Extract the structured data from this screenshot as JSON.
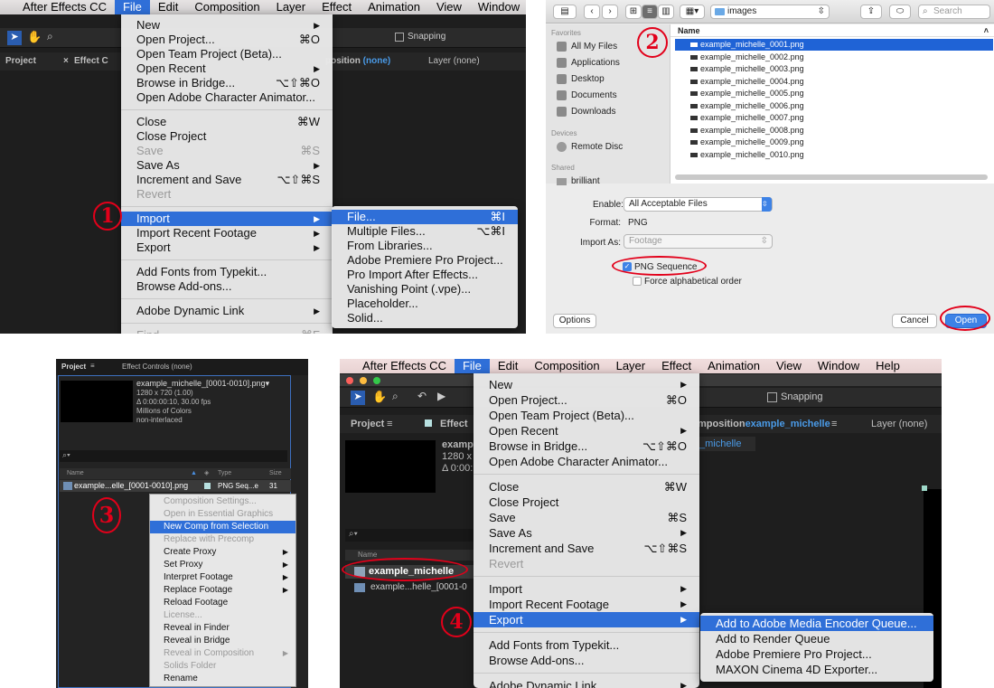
{
  "panel1": {
    "menubar": [
      "After Effects CC",
      "File",
      "Edit",
      "Composition",
      "Layer",
      "Effect",
      "Animation",
      "View",
      "Window",
      "Help"
    ],
    "tab_project": "Project",
    "tab_effect": "Effect C",
    "tab_comp": "position",
    "tab_comp_value": "(none)",
    "tab_layer": "Layer (none)",
    "snapping": "Snapping",
    "step": "1",
    "file_menu": [
      {
        "label": "New",
        "sc": "",
        "arrow": true
      },
      {
        "label": "Open Project...",
        "sc": "⌘O"
      },
      {
        "label": "Open Team Project (Beta)...",
        "sc": ""
      },
      {
        "label": "Open Recent",
        "sc": "",
        "arrow": true
      },
      {
        "label": "Browse in Bridge...",
        "sc": "⌥⇧⌘O"
      },
      {
        "label": "Open Adobe Character Animator...",
        "sc": ""
      },
      {
        "sep": true
      },
      {
        "label": "Close",
        "sc": "⌘W"
      },
      {
        "label": "Close Project",
        "sc": ""
      },
      {
        "label": "Save",
        "sc": "⌘S",
        "dis": true
      },
      {
        "label": "Save As",
        "sc": "",
        "arrow": true
      },
      {
        "label": "Increment and Save",
        "sc": "⌥⇧⌘S"
      },
      {
        "label": "Revert",
        "sc": "",
        "dis": true
      },
      {
        "sep": true
      },
      {
        "label": "Import",
        "sc": "",
        "arrow": true,
        "hl": true
      },
      {
        "label": "Import Recent Footage",
        "sc": "",
        "arrow": true
      },
      {
        "label": "Export",
        "sc": "",
        "arrow": true
      },
      {
        "sep": true
      },
      {
        "label": "Add Fonts from Typekit...",
        "sc": ""
      },
      {
        "label": "Browse Add-ons...",
        "sc": ""
      },
      {
        "sep": true
      },
      {
        "label": "Adobe Dynamic Link",
        "sc": "",
        "arrow": true
      },
      {
        "sep": true
      },
      {
        "label": "Find...",
        "sc": "⌘F",
        "dis": true
      }
    ],
    "import_menu": [
      {
        "label": "File...",
        "sc": "⌘I",
        "hl": true
      },
      {
        "label": "Multiple Files...",
        "sc": "⌥⌘I"
      },
      {
        "label": "From Libraries...",
        "sc": ""
      },
      {
        "label": "Adobe Premiere Pro Project...",
        "sc": ""
      },
      {
        "label": "Pro Import After Effects...",
        "sc": ""
      },
      {
        "label": "Vanishing Point (.vpe)...",
        "sc": ""
      },
      {
        "label": "Placeholder...",
        "sc": ""
      },
      {
        "label": "Solid...",
        "sc": ""
      }
    ]
  },
  "panel2": {
    "step": "2",
    "path": "images",
    "search_placeholder": "Search",
    "favorites_head": "Favorites",
    "favorites": [
      "All My Files",
      "Applications",
      "Desktop",
      "Documents",
      "Downloads"
    ],
    "devices_head": "Devices",
    "devices": [
      "Remote Disc"
    ],
    "shared_head": "Shared",
    "shared": [
      "brilliant"
    ],
    "column_name": "Name",
    "files": [
      "example_michelle_0001.png",
      "example_michelle_0002.png",
      "example_michelle_0003.png",
      "example_michelle_0004.png",
      "example_michelle_0005.png",
      "example_michelle_0006.png",
      "example_michelle_0007.png",
      "example_michelle_0008.png",
      "example_michelle_0009.png",
      "example_michelle_0010.png"
    ],
    "enable_label": "Enable:",
    "enable_value": "All Acceptable Files",
    "format_label": "Format:",
    "format_value": "PNG",
    "import_as_label": "Import As:",
    "import_as_value": "Footage",
    "png_sequence": "PNG Sequence",
    "force_alpha": "Force alphabetical order",
    "options": "Options",
    "cancel": "Cancel",
    "open": "Open"
  },
  "panel3": {
    "step": "3",
    "tab_project": "Project",
    "tab_effect": "Effect Controls (none)",
    "item_name": "example_michelle_[0001-0010].png▾",
    "info": [
      "1280 x 720 (1.00)",
      "Δ 0:00:00:10, 30.00 fps",
      "Millions of Colors",
      "non-interlaced"
    ],
    "col_name": "Name",
    "col_type": "Type",
    "col_size": "Size",
    "row_name": "example...elle_[0001-0010].png",
    "row_type": "PNG Seq...e",
    "row_size": "31",
    "context_menu": [
      {
        "label": "Composition Settings...",
        "dis": true
      },
      {
        "label": "Open in Essential Graphics",
        "dis": true
      },
      {
        "label": "New Comp from Selection",
        "hl": true
      },
      {
        "label": "Replace with Precomp",
        "dis": true
      },
      {
        "label": "Create Proxy",
        "arrow": true
      },
      {
        "label": "Set Proxy",
        "arrow": true
      },
      {
        "label": "Interpret Footage",
        "arrow": true
      },
      {
        "label": "Replace Footage",
        "arrow": true
      },
      {
        "label": "Reload Footage"
      },
      {
        "label": "License...",
        "dis": true
      },
      {
        "label": "Reveal in Finder"
      },
      {
        "label": "Reveal in Bridge"
      },
      {
        "label": "Reveal in Composition",
        "dis": true,
        "arrow": true
      },
      {
        "label": "Solids Folder",
        "dis": true
      },
      {
        "label": "Rename"
      }
    ]
  },
  "panel4": {
    "step": "4",
    "menubar": [
      "After Effects CC",
      "File",
      "Edit",
      "Composition",
      "Layer",
      "Effect",
      "Animation",
      "View",
      "Window",
      "Help"
    ],
    "tab_project": "Project",
    "tab_effect": "Effect",
    "tab_comp": "mposition",
    "tab_comp_value": "example_michelle",
    "tab_layer": "Layer (none)",
    "comp_tab": "_michelle",
    "snapping": "Snapping",
    "info_partial": [
      "examp",
      "1280 x",
      "Δ 0:00:"
    ],
    "col_name": "Name",
    "item1": "example_michelle",
    "item2": "example...helle_[0001-0",
    "file_menu": [
      {
        "label": "New",
        "sc": "",
        "arrow": true
      },
      {
        "label": "Open Project...",
        "sc": "⌘O"
      },
      {
        "label": "Open Team Project (Beta)...",
        "sc": ""
      },
      {
        "label": "Open Recent",
        "sc": "",
        "arrow": true
      },
      {
        "label": "Browse in Bridge...",
        "sc": "⌥⇧⌘O"
      },
      {
        "label": "Open Adobe Character Animator...",
        "sc": ""
      },
      {
        "sep": true
      },
      {
        "label": "Close",
        "sc": "⌘W"
      },
      {
        "label": "Close Project",
        "sc": ""
      },
      {
        "label": "Save",
        "sc": "⌘S"
      },
      {
        "label": "Save As",
        "sc": "",
        "arrow": true
      },
      {
        "label": "Increment and Save",
        "sc": "⌥⇧⌘S"
      },
      {
        "label": "Revert",
        "sc": "",
        "dis": true
      },
      {
        "sep": true
      },
      {
        "label": "Import",
        "sc": "",
        "arrow": true
      },
      {
        "label": "Import Recent Footage",
        "sc": "",
        "arrow": true
      },
      {
        "label": "Export",
        "sc": "",
        "arrow": true,
        "hl": true
      },
      {
        "sep": true
      },
      {
        "label": "Add Fonts from Typekit...",
        "sc": ""
      },
      {
        "label": "Browse Add-ons...",
        "sc": ""
      },
      {
        "sep": true
      },
      {
        "label": "Adobe Dynamic Link",
        "sc": "",
        "arrow": true
      }
    ],
    "export_menu": [
      {
        "label": "Add to Adobe Media Encoder Queue...",
        "hl": true
      },
      {
        "label": "Add to Render Queue"
      },
      {
        "label": "Adobe Premiere Pro Project..."
      },
      {
        "label": "MAXON Cinema 4D Exporter..."
      }
    ]
  }
}
